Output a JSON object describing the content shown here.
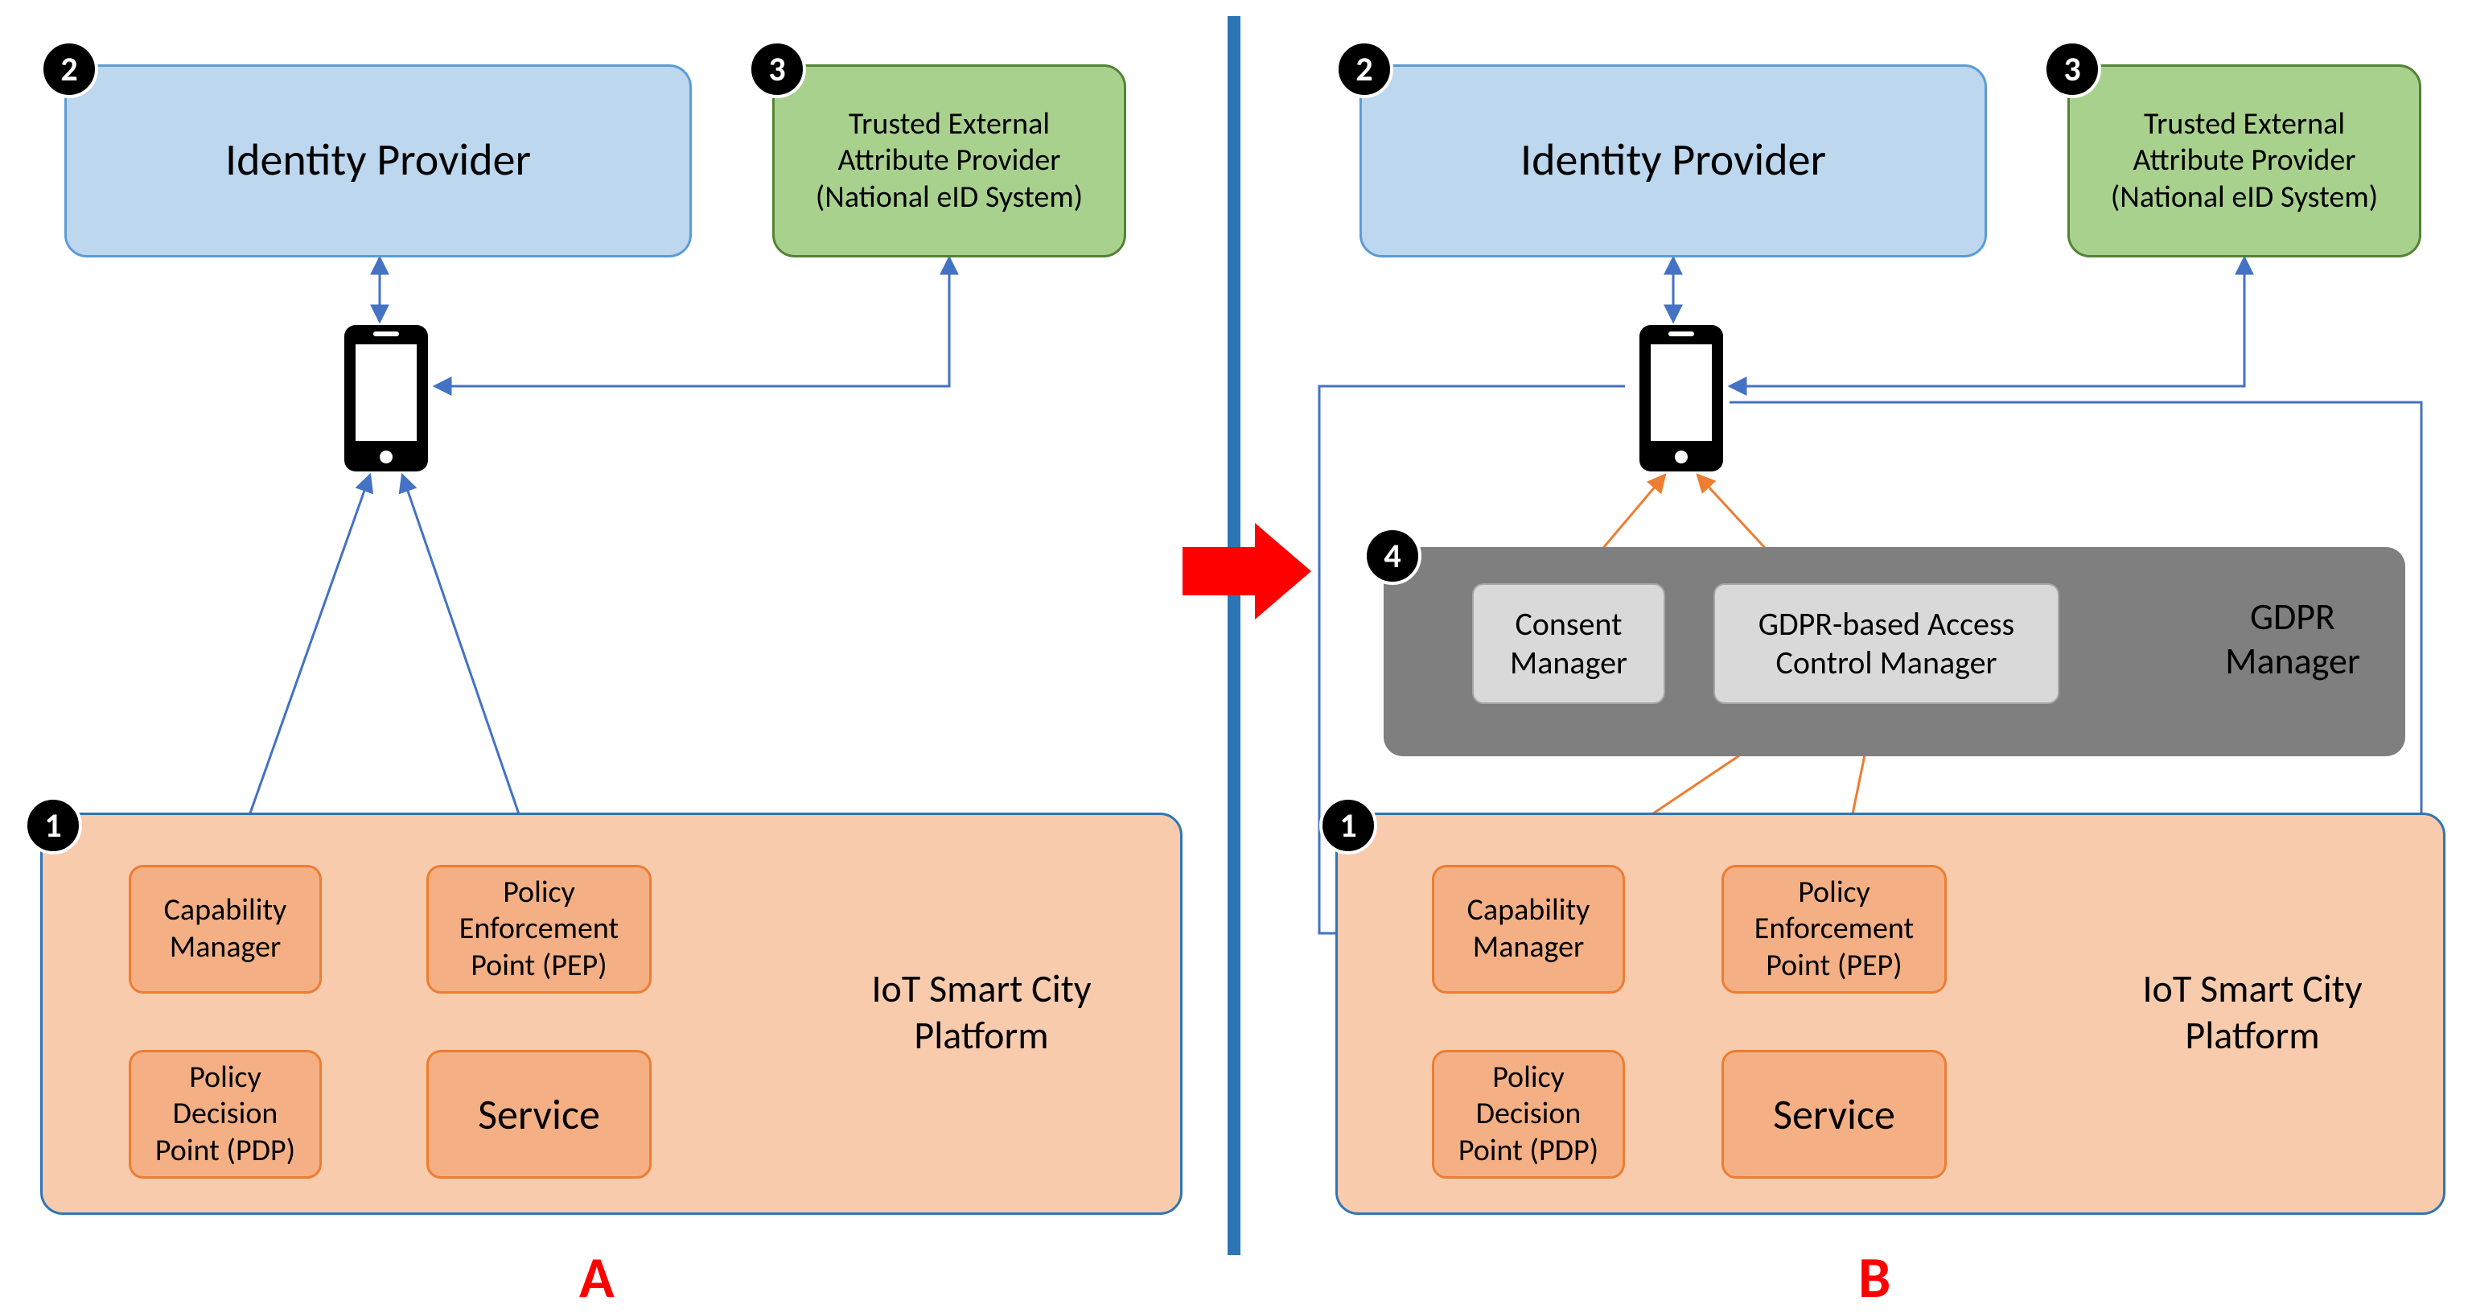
{
  "panelA": {
    "label": "A",
    "identity_provider": {
      "badge": "2",
      "title": "Identity Provider"
    },
    "attribute_provider": {
      "badge": "3",
      "line1": "Trusted External",
      "line2": "Attribute Provider",
      "line3": "(National eID System)"
    },
    "iot_platform": {
      "badge": "1",
      "title_line1": "IoT Smart City",
      "title_line2": "Platform",
      "capability_manager": "Capability\nManager",
      "pep": "Policy\nEnforcement\nPoint (PEP)",
      "pdp": "Policy\nDecision\nPoint (PDP)",
      "service": "Service"
    }
  },
  "panelB": {
    "label": "B",
    "identity_provider": {
      "badge": "2",
      "title": "Identity Provider"
    },
    "attribute_provider": {
      "badge": "3",
      "line1": "Trusted External",
      "line2": "Attribute Provider",
      "line3": "(National eID System)"
    },
    "gdpr_manager": {
      "badge": "4",
      "title_line1": "GDPR",
      "title_line2": "Manager",
      "consent_manager": "Consent\nManager",
      "access_control": "GDPR-based Access\nControl Manager"
    },
    "iot_platform": {
      "badge": "1",
      "title_line1": "IoT Smart City",
      "title_line2": "Platform",
      "capability_manager": "Capability\nManager",
      "pep": "Policy\nEnforcement\nPoint (PEP)",
      "pdp": "Policy\nDecision\nPoint (PDP)",
      "service": "Service"
    }
  },
  "colors": {
    "blue_fill": "#bdd7ee",
    "blue_border": "#5b9bd5",
    "green_fill": "#a9d18e",
    "green_border": "#548235",
    "peach_fill": "#f8cbad",
    "peach_sub_fill": "#f4b084",
    "orange_border": "#ed7d31",
    "gray_fill": "#7f7f7f",
    "gray_sub_fill": "#d9d9d9",
    "divider": "#2e75b6",
    "arrow_blue": "#4472c4",
    "arrow_orange": "#ed7d31",
    "red": "#ff0000"
  }
}
